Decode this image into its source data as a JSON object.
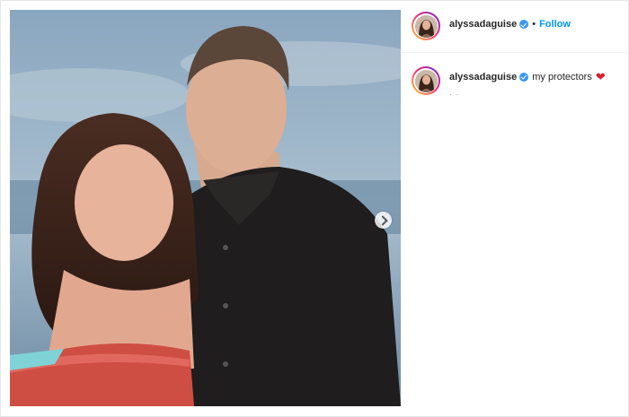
{
  "post": {
    "username": "alyssadaguise",
    "follow_label": "Follow",
    "separator": "•",
    "caption": "my protectors",
    "caption_emoji": "❤",
    "caption_meta": "· ·"
  },
  "icons": {
    "verified": "verified-badge-icon",
    "carousel_next": "chevron-right-icon",
    "heart": "red-heart-emoji"
  },
  "colors": {
    "link": "#0095f6",
    "verified": "#3897f0",
    "heart": "#d4232c"
  }
}
